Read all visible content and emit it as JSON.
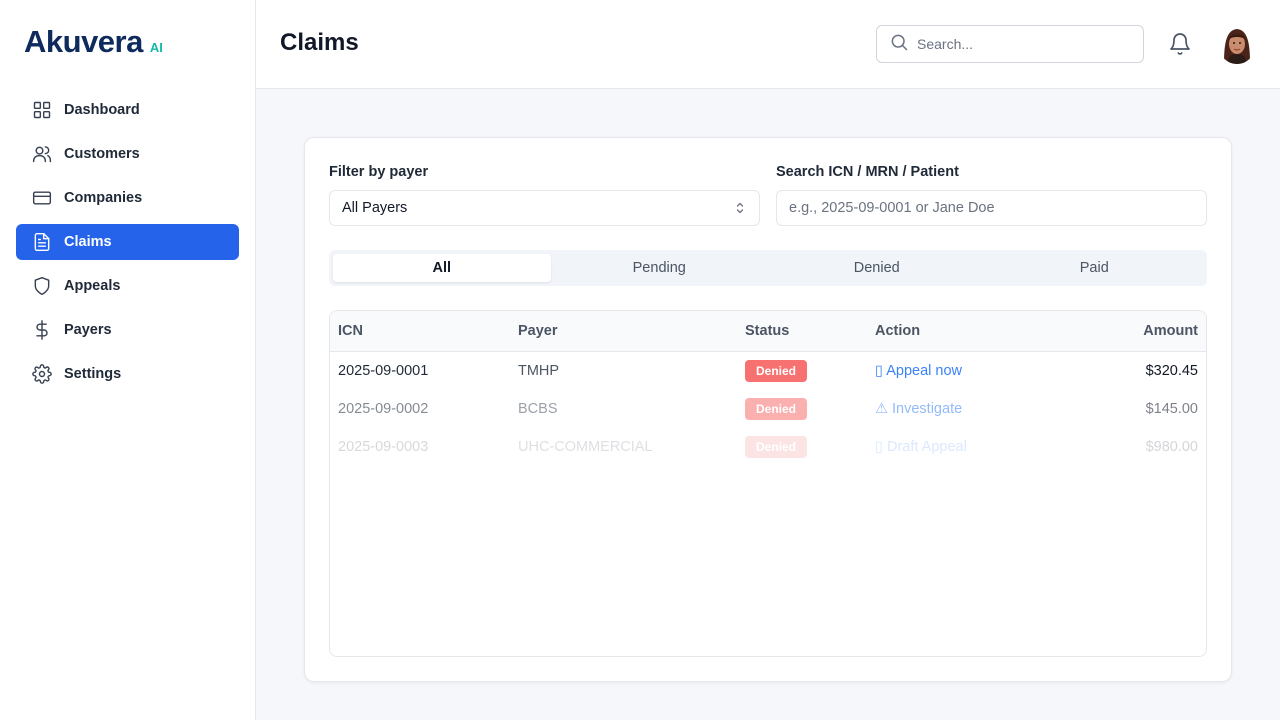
{
  "brand": {
    "name": "Akuvera",
    "suffix": "AI"
  },
  "sidebar": {
    "items": [
      {
        "label": "Dashboard",
        "icon": "grid-icon",
        "active": false
      },
      {
        "label": "Customers",
        "icon": "users-icon",
        "active": false
      },
      {
        "label": "Companies",
        "icon": "credit-card-icon",
        "active": false
      },
      {
        "label": "Claims",
        "icon": "document-icon",
        "active": true
      },
      {
        "label": "Appeals",
        "icon": "shield-icon",
        "active": false
      },
      {
        "label": "Payers",
        "icon": "dollar-icon",
        "active": false
      },
      {
        "label": "Settings",
        "icon": "gear-icon",
        "active": false
      }
    ]
  },
  "header": {
    "title": "Claims",
    "search_placeholder": "Search..."
  },
  "filters": {
    "payer_label": "Filter by payer",
    "payer_value": "All Payers",
    "search_label": "Search ICN / MRN / Patient",
    "search_placeholder": "e.g., 2025-09-0001 or Jane Doe"
  },
  "tabs": [
    {
      "label": "All",
      "active": true
    },
    {
      "label": "Pending",
      "active": false
    },
    {
      "label": "Denied",
      "active": false
    },
    {
      "label": "Paid",
      "active": false
    }
  ],
  "table": {
    "headers": {
      "icn": "ICN",
      "payer": "Payer",
      "status": "Status",
      "action": "Action",
      "amount": "Amount"
    },
    "rows": [
      {
        "icn": "2025-09-0001",
        "payer": "TMHP",
        "status": "Denied",
        "action": "▯ Appeal now",
        "amount": "$320.45"
      },
      {
        "icn": "2025-09-0002",
        "payer": "BCBS",
        "status": "Denied",
        "action": "⚠ Investigate",
        "amount": "$145.00"
      },
      {
        "icn": "2025-09-0003",
        "payer": "UHC-COMMERCIAL",
        "status": "Denied",
        "action": "▯ Draft Appeal",
        "amount": "$980.00"
      }
    ]
  },
  "colors": {
    "primary": "#2563eb",
    "brand": "#0f2a5c",
    "accent": "#14b8a6",
    "denied": "#f87171",
    "link": "#3b82f6"
  }
}
